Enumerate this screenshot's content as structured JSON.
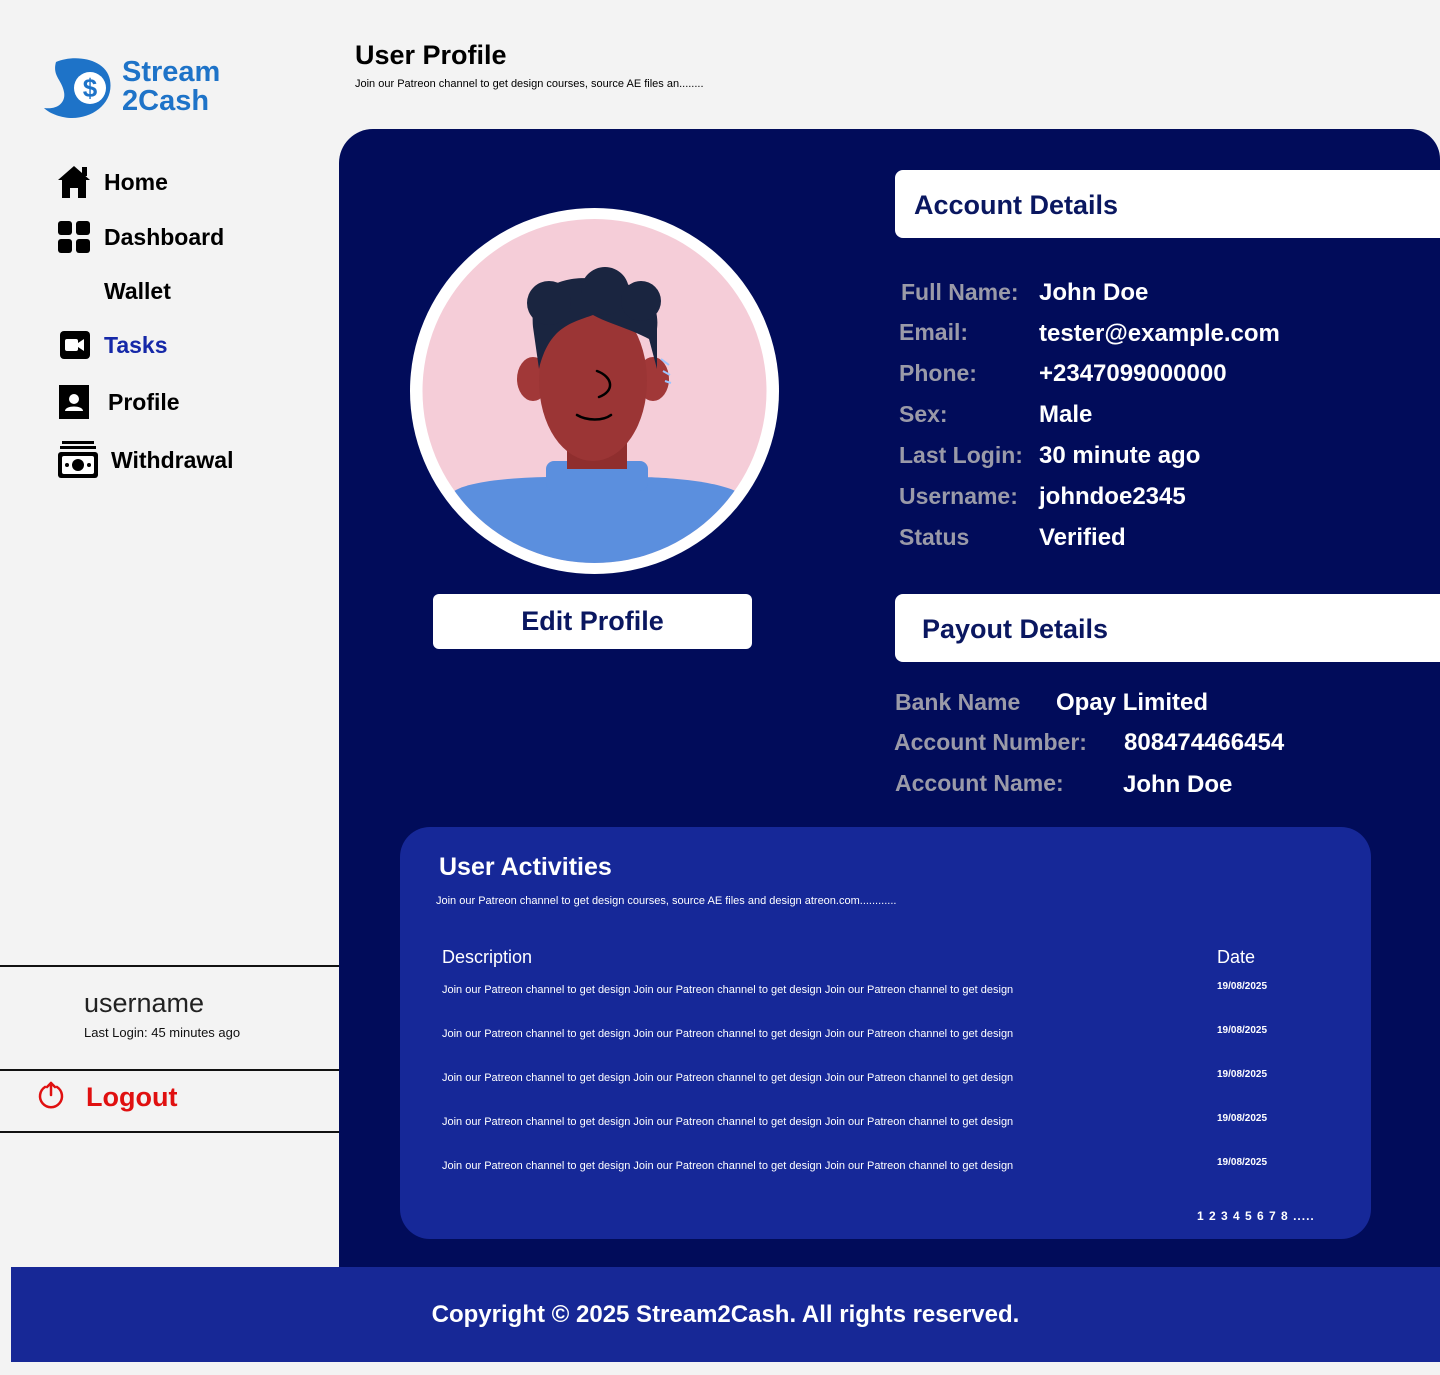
{
  "brand": {
    "line1": "Stream",
    "line2": "2Cash"
  },
  "nav": [
    {
      "label": "Home",
      "icon": "home-icon"
    },
    {
      "label": "Dashboard",
      "icon": "dashboard-icon"
    },
    {
      "label": "Wallet",
      "icon": ""
    },
    {
      "label": "Tasks",
      "icon": "video-icon",
      "active": true
    },
    {
      "label": "Profile",
      "icon": "profile-icon"
    },
    {
      "label": "Withdrawal",
      "icon": "cash-icon"
    }
  ],
  "user": {
    "name": "username",
    "last_login": "Last Login: 45 minutes ago"
  },
  "logout_label": "Logout",
  "header": {
    "title": "User Profile",
    "subtitle": "Join our Patreon channel to get design courses, source AE files an........"
  },
  "edit_profile_label": "Edit Profile",
  "account": {
    "title": "Account Details",
    "fields": [
      {
        "key": "Full Name:",
        "value": "John Doe"
      },
      {
        "key": "Email:",
        "value": "tester@example.com"
      },
      {
        "key": "Phone:",
        "value": "+2347099000000"
      },
      {
        "key": "Sex:",
        "value": "Male"
      },
      {
        "key": "Last Login:",
        "value": "30 minute ago"
      },
      {
        "key": "Username:",
        "value": "johndoe2345"
      },
      {
        "key": "Status",
        "value": "Verified"
      }
    ]
  },
  "payout": {
    "title": "Payout Details",
    "fields": [
      {
        "key": "Bank Name",
        "value": "Opay Limited"
      },
      {
        "key": "Account Number:",
        "value": "808474466454"
      },
      {
        "key": "Account Name:",
        "value": "John Doe"
      }
    ]
  },
  "activities": {
    "title": "User Activities",
    "subtitle": "Join our Patreon channel to get design courses, source AE files and design atreon.com............",
    "col_description": "Description",
    "col_date": "Date",
    "rows": [
      {
        "description": "Join our Patreon channel to get design  Join our Patreon channel to get design Join our Patreon channel to get design",
        "date": "19/08/2025"
      },
      {
        "description": "Join our Patreon channel to get design  Join our Patreon channel to get design Join our Patreon channel to get design",
        "date": "19/08/2025"
      },
      {
        "description": "Join our Patreon channel to get design  Join our Patreon channel to get design Join our Patreon channel to get design",
        "date": "19/08/2025"
      },
      {
        "description": "Join our Patreon channel to get design  Join our Patreon channel to get design Join our Patreon channel to get design",
        "date": "19/08/2025"
      },
      {
        "description": "Join our Patreon channel to get design  Join our Patreon channel to get design Join our Patreon channel to get design",
        "date": "19/08/2025"
      }
    ],
    "pagination": "1 2 3 4 5 6 7 8 ....."
  },
  "footer": {
    "copyright": "Copyright © 2025 Stream2Cash. All rights reserved."
  },
  "colors": {
    "panel": "#010c5a",
    "activities": "#162898",
    "footer": "#172896",
    "accent": "#1528a8",
    "logout": "#e01010"
  }
}
